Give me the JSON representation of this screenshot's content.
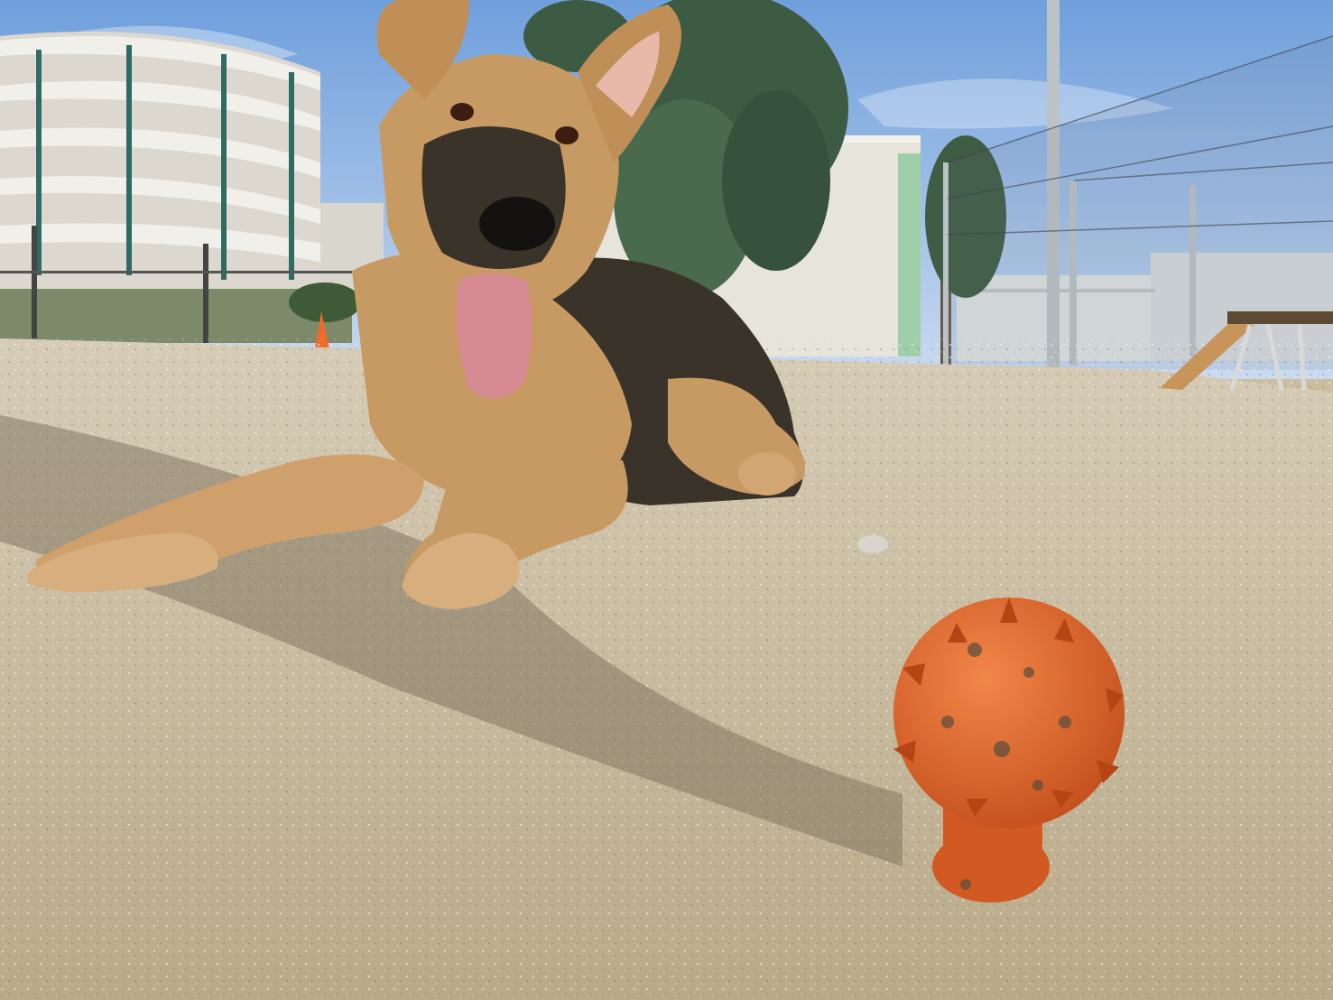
{
  "photo": {
    "subject": "german-shepherd-lying-on-sand",
    "objects": [
      {
        "name": "sky"
      },
      {
        "name": "parking-garage"
      },
      {
        "name": "warehouse-building"
      },
      {
        "name": "eucalyptus-tree"
      },
      {
        "name": "sports-net-fence"
      },
      {
        "name": "traffic-cone"
      },
      {
        "name": "agility-ramp"
      },
      {
        "name": "german-shepherd-dog"
      },
      {
        "name": "orange-spiked-ball-toy"
      },
      {
        "name": "sandy-ground"
      }
    ]
  },
  "colors": {
    "sky_top": "#6f9fdc",
    "sky_bottom": "#c9daf0",
    "ground": "#c9bca0",
    "ground_shadow": "#8d806a",
    "dog_tan": "#c89a63",
    "dog_dark": "#3a3329",
    "tongue": "#d68a92",
    "toy": "#e2692c",
    "building": "#e7e4dc",
    "cone": "#ef6a2a"
  }
}
